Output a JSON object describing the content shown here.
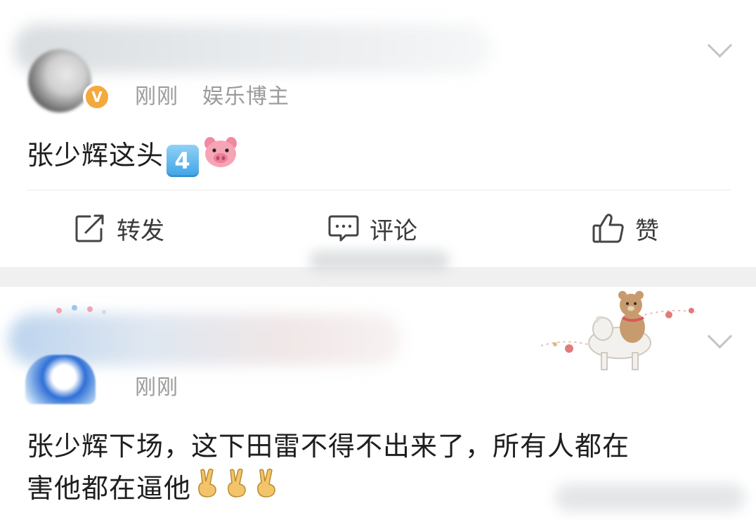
{
  "post1": {
    "time": "刚刚",
    "user_tag": "娱乐博主",
    "verified_badge": "V",
    "text": "张少辉这头",
    "emojis": [
      "keycap-4-emoji",
      "pig-face-emoji"
    ],
    "emoji_keycap_text": "4",
    "actions": {
      "repost": "转发",
      "comment": "评论",
      "like": "赞"
    }
  },
  "post2": {
    "time": "刚刚",
    "text_line1": "张少辉下场，这下田雷不得不出来了，所有人都在",
    "text_line2": "害他都在逼他",
    "emojis": [
      "victory-hand-emoji",
      "victory-hand-emoji",
      "victory-hand-emoji"
    ]
  },
  "colors": {
    "meta_text": "#9a9a9a",
    "body_text": "#1e1e1e",
    "verified_badge": "#f3a93b",
    "divider_band": "#f0f0f0"
  }
}
